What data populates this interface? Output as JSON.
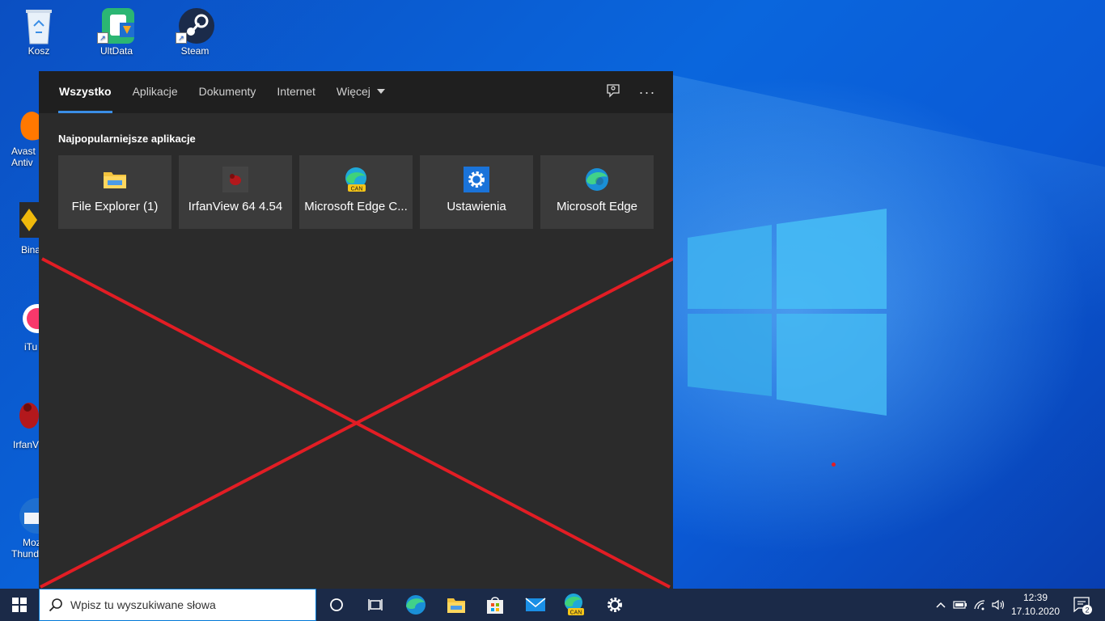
{
  "desktop": {
    "icons": [
      {
        "name": "recycle-bin",
        "label": "Kosz",
        "icon": "recycle-bin-icon"
      },
      {
        "name": "ultdata",
        "label": "UltData",
        "icon": "ultdata-icon"
      },
      {
        "name": "steam",
        "label": "Steam",
        "icon": "steam-icon"
      }
    ],
    "partial_icons": [
      {
        "label1": "Avast",
        "label2": "Antiv"
      },
      {
        "label1": "Bina",
        "label2": ""
      },
      {
        "label1": "iTu",
        "label2": ""
      },
      {
        "label1": "IrfanV",
        "label2": ""
      },
      {
        "label1": "Moz",
        "label2": "Thund"
      }
    ]
  },
  "search_panel": {
    "tabs": [
      {
        "label": "Wszystko",
        "active": true
      },
      {
        "label": "Aplikacje"
      },
      {
        "label": "Dokumenty"
      },
      {
        "label": "Internet"
      },
      {
        "label": "Więcej"
      }
    ],
    "section_title": "Najpopularniejsze aplikacje",
    "apps": [
      {
        "label": "File Explorer (1)",
        "icon": "folder-icon"
      },
      {
        "label": "IrfanView 64 4.54",
        "icon": "irfanview-icon"
      },
      {
        "label": "Microsoft Edge C...",
        "icon": "edge-canary-icon"
      },
      {
        "label": "Ustawienia",
        "icon": "gear-icon"
      },
      {
        "label": "Microsoft Edge",
        "icon": "edge-icon"
      }
    ]
  },
  "taskbar": {
    "search_placeholder": "Wpisz tu wyszukiwane słowa",
    "time": "12:39",
    "date": "17.10.2020",
    "notification_count": "2",
    "edge_canary_badge": "CAN"
  },
  "colors": {
    "accent": "#3a8ee6",
    "panel_bg": "#2b2b2b",
    "tile_bg": "#3b3b3b",
    "taskbar_bg": "#1b2a48",
    "annotation": "#e21d24"
  }
}
